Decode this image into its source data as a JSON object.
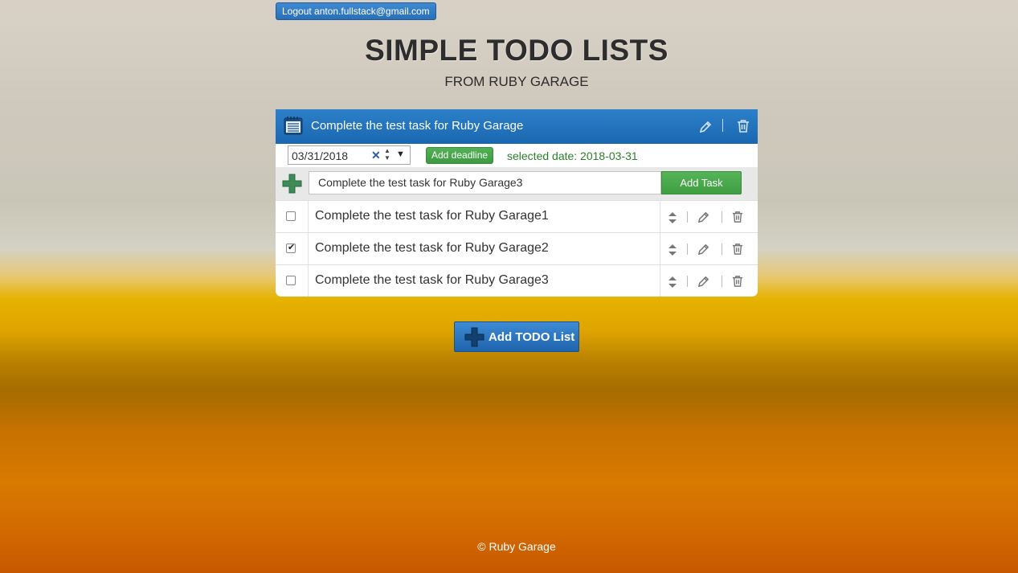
{
  "header": {
    "logout_label": "Logout anton.fullstack@gmail.com",
    "title": "SIMPLE TODO LISTS",
    "subtitle": "FROM RUBY GARAGE"
  },
  "todo_list": {
    "title": "Complete the test task for Ruby Garage",
    "deadline": {
      "date_value": "03/31/2018",
      "button_label": "Add deadline",
      "selected_date_text": "selected date: 2018-03-31"
    },
    "new_task": {
      "value": "Complete the test task for Ruby Garage3",
      "button_label": "Add Task"
    },
    "tasks": [
      {
        "text": "Complete the test task for Ruby Garage1",
        "done": false
      },
      {
        "text": "Complete the test task for Ruby Garage2",
        "done": true
      },
      {
        "text": "Complete the test task for Ruby Garage3",
        "done": false
      }
    ]
  },
  "add_list_button": "Add TODO List",
  "footer": "© Ruby Garage",
  "icons": {
    "list": "calendar-list-icon",
    "edit": "pencil-icon",
    "delete": "trash-icon",
    "sort": "sort-arrows-icon",
    "add": "plus-icon"
  },
  "colors": {
    "header_blue": "#1f6fb8",
    "green": "#43a047",
    "selected_date_green": "#2a7f2a"
  }
}
